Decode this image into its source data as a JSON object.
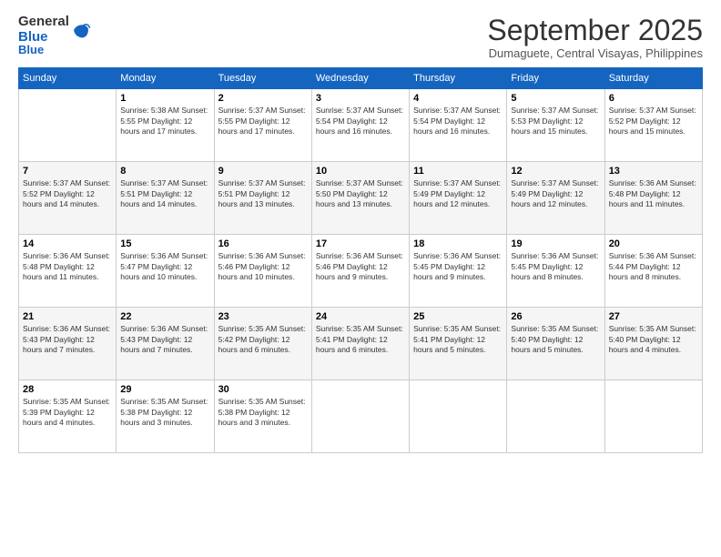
{
  "header": {
    "logo_general": "General",
    "logo_blue": "Blue",
    "month": "September 2025",
    "location": "Dumaguete, Central Visayas, Philippines"
  },
  "days_of_week": [
    "Sunday",
    "Monday",
    "Tuesday",
    "Wednesday",
    "Thursday",
    "Friday",
    "Saturday"
  ],
  "weeks": [
    [
      {
        "day": "",
        "info": ""
      },
      {
        "day": "1",
        "info": "Sunrise: 5:38 AM\nSunset: 5:55 PM\nDaylight: 12 hours\nand 17 minutes."
      },
      {
        "day": "2",
        "info": "Sunrise: 5:37 AM\nSunset: 5:55 PM\nDaylight: 12 hours\nand 17 minutes."
      },
      {
        "day": "3",
        "info": "Sunrise: 5:37 AM\nSunset: 5:54 PM\nDaylight: 12 hours\nand 16 minutes."
      },
      {
        "day": "4",
        "info": "Sunrise: 5:37 AM\nSunset: 5:54 PM\nDaylight: 12 hours\nand 16 minutes."
      },
      {
        "day": "5",
        "info": "Sunrise: 5:37 AM\nSunset: 5:53 PM\nDaylight: 12 hours\nand 15 minutes."
      },
      {
        "day": "6",
        "info": "Sunrise: 5:37 AM\nSunset: 5:52 PM\nDaylight: 12 hours\nand 15 minutes."
      }
    ],
    [
      {
        "day": "7",
        "info": "Sunrise: 5:37 AM\nSunset: 5:52 PM\nDaylight: 12 hours\nand 14 minutes."
      },
      {
        "day": "8",
        "info": "Sunrise: 5:37 AM\nSunset: 5:51 PM\nDaylight: 12 hours\nand 14 minutes."
      },
      {
        "day": "9",
        "info": "Sunrise: 5:37 AM\nSunset: 5:51 PM\nDaylight: 12 hours\nand 13 minutes."
      },
      {
        "day": "10",
        "info": "Sunrise: 5:37 AM\nSunset: 5:50 PM\nDaylight: 12 hours\nand 13 minutes."
      },
      {
        "day": "11",
        "info": "Sunrise: 5:37 AM\nSunset: 5:49 PM\nDaylight: 12 hours\nand 12 minutes."
      },
      {
        "day": "12",
        "info": "Sunrise: 5:37 AM\nSunset: 5:49 PM\nDaylight: 12 hours\nand 12 minutes."
      },
      {
        "day": "13",
        "info": "Sunrise: 5:36 AM\nSunset: 5:48 PM\nDaylight: 12 hours\nand 11 minutes."
      }
    ],
    [
      {
        "day": "14",
        "info": "Sunrise: 5:36 AM\nSunset: 5:48 PM\nDaylight: 12 hours\nand 11 minutes."
      },
      {
        "day": "15",
        "info": "Sunrise: 5:36 AM\nSunset: 5:47 PM\nDaylight: 12 hours\nand 10 minutes."
      },
      {
        "day": "16",
        "info": "Sunrise: 5:36 AM\nSunset: 5:46 PM\nDaylight: 12 hours\nand 10 minutes."
      },
      {
        "day": "17",
        "info": "Sunrise: 5:36 AM\nSunset: 5:46 PM\nDaylight: 12 hours\nand 9 minutes."
      },
      {
        "day": "18",
        "info": "Sunrise: 5:36 AM\nSunset: 5:45 PM\nDaylight: 12 hours\nand 9 minutes."
      },
      {
        "day": "19",
        "info": "Sunrise: 5:36 AM\nSunset: 5:45 PM\nDaylight: 12 hours\nand 8 minutes."
      },
      {
        "day": "20",
        "info": "Sunrise: 5:36 AM\nSunset: 5:44 PM\nDaylight: 12 hours\nand 8 minutes."
      }
    ],
    [
      {
        "day": "21",
        "info": "Sunrise: 5:36 AM\nSunset: 5:43 PM\nDaylight: 12 hours\nand 7 minutes."
      },
      {
        "day": "22",
        "info": "Sunrise: 5:36 AM\nSunset: 5:43 PM\nDaylight: 12 hours\nand 7 minutes."
      },
      {
        "day": "23",
        "info": "Sunrise: 5:35 AM\nSunset: 5:42 PM\nDaylight: 12 hours\nand 6 minutes."
      },
      {
        "day": "24",
        "info": "Sunrise: 5:35 AM\nSunset: 5:41 PM\nDaylight: 12 hours\nand 6 minutes."
      },
      {
        "day": "25",
        "info": "Sunrise: 5:35 AM\nSunset: 5:41 PM\nDaylight: 12 hours\nand 5 minutes."
      },
      {
        "day": "26",
        "info": "Sunrise: 5:35 AM\nSunset: 5:40 PM\nDaylight: 12 hours\nand 5 minutes."
      },
      {
        "day": "27",
        "info": "Sunrise: 5:35 AM\nSunset: 5:40 PM\nDaylight: 12 hours\nand 4 minutes."
      }
    ],
    [
      {
        "day": "28",
        "info": "Sunrise: 5:35 AM\nSunset: 5:39 PM\nDaylight: 12 hours\nand 4 minutes."
      },
      {
        "day": "29",
        "info": "Sunrise: 5:35 AM\nSunset: 5:38 PM\nDaylight: 12 hours\nand 3 minutes."
      },
      {
        "day": "30",
        "info": "Sunrise: 5:35 AM\nSunset: 5:38 PM\nDaylight: 12 hours\nand 3 minutes."
      },
      {
        "day": "",
        "info": ""
      },
      {
        "day": "",
        "info": ""
      },
      {
        "day": "",
        "info": ""
      },
      {
        "day": "",
        "info": ""
      }
    ]
  ]
}
